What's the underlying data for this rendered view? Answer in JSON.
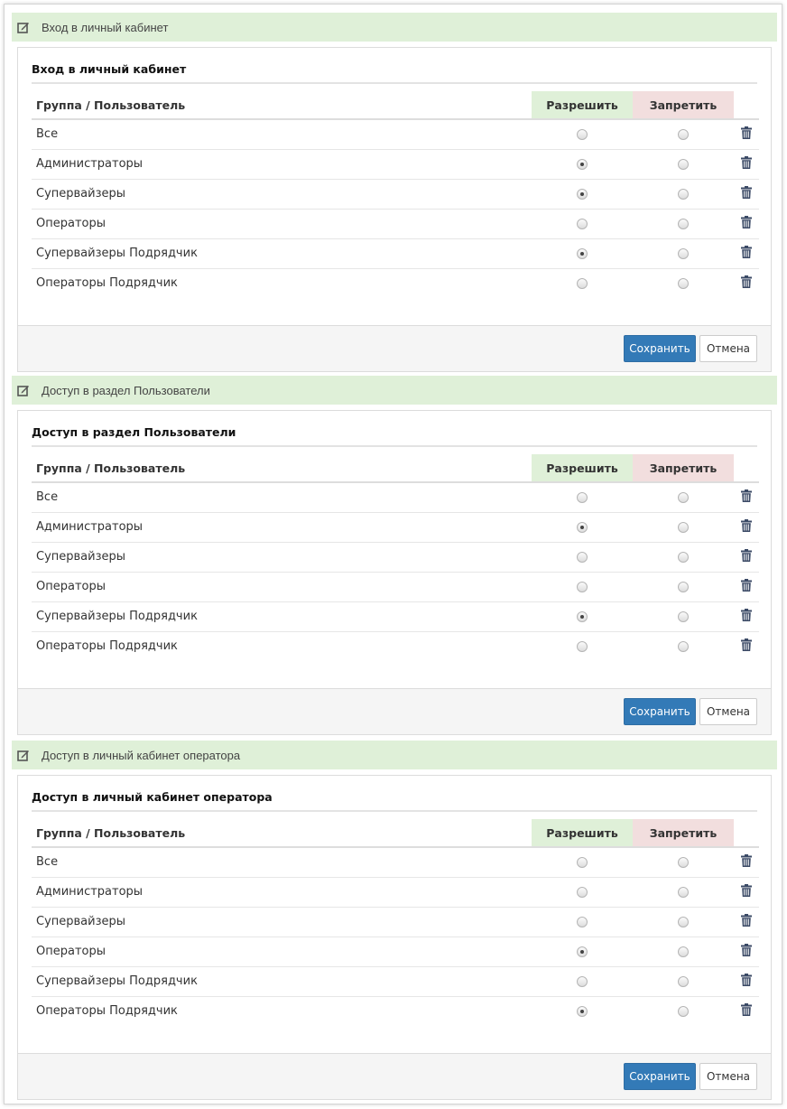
{
  "columns": {
    "name": "Группа / Пользователь",
    "allow": "Разрешить",
    "deny": "Запретить"
  },
  "buttons": {
    "save": "Сохранить",
    "cancel": "Отмена"
  },
  "colors": {
    "header_bg": "#dff0d8",
    "deny_bg": "#f2dede",
    "primary": "#337ab7"
  },
  "sections": [
    {
      "header": "Вход в личный кабинет",
      "title": "Вход в личный кабинет",
      "rows": [
        {
          "name": "Все",
          "allow": false,
          "deny": false
        },
        {
          "name": "Администраторы",
          "allow": true,
          "deny": false
        },
        {
          "name": "Супервайзеры",
          "allow": true,
          "deny": false
        },
        {
          "name": "Операторы",
          "allow": false,
          "deny": false
        },
        {
          "name": "Супервайзеры Подрядчик",
          "allow": true,
          "deny": false
        },
        {
          "name": "Операторы Подрядчик",
          "allow": false,
          "deny": false
        }
      ]
    },
    {
      "header": "Доступ в раздел Пользователи",
      "title": "Доступ в раздел Пользователи",
      "rows": [
        {
          "name": "Все",
          "allow": false,
          "deny": false
        },
        {
          "name": "Администраторы",
          "allow": true,
          "deny": false
        },
        {
          "name": "Супервайзеры",
          "allow": false,
          "deny": false
        },
        {
          "name": "Операторы",
          "allow": false,
          "deny": false
        },
        {
          "name": "Супервайзеры Подрядчик",
          "allow": true,
          "deny": false
        },
        {
          "name": "Операторы Подрядчик",
          "allow": false,
          "deny": false
        }
      ]
    },
    {
      "header": "Доступ в личный кабинет оператора",
      "title": "Доступ в личный кабинет оператора",
      "rows": [
        {
          "name": "Все",
          "allow": false,
          "deny": false
        },
        {
          "name": "Администраторы",
          "allow": false,
          "deny": false
        },
        {
          "name": "Супервайзеры",
          "allow": false,
          "deny": false
        },
        {
          "name": "Операторы",
          "allow": true,
          "deny": false
        },
        {
          "name": "Супервайзеры Подрядчик",
          "allow": false,
          "deny": false
        },
        {
          "name": "Операторы Подрядчик",
          "allow": true,
          "deny": false
        }
      ]
    }
  ]
}
